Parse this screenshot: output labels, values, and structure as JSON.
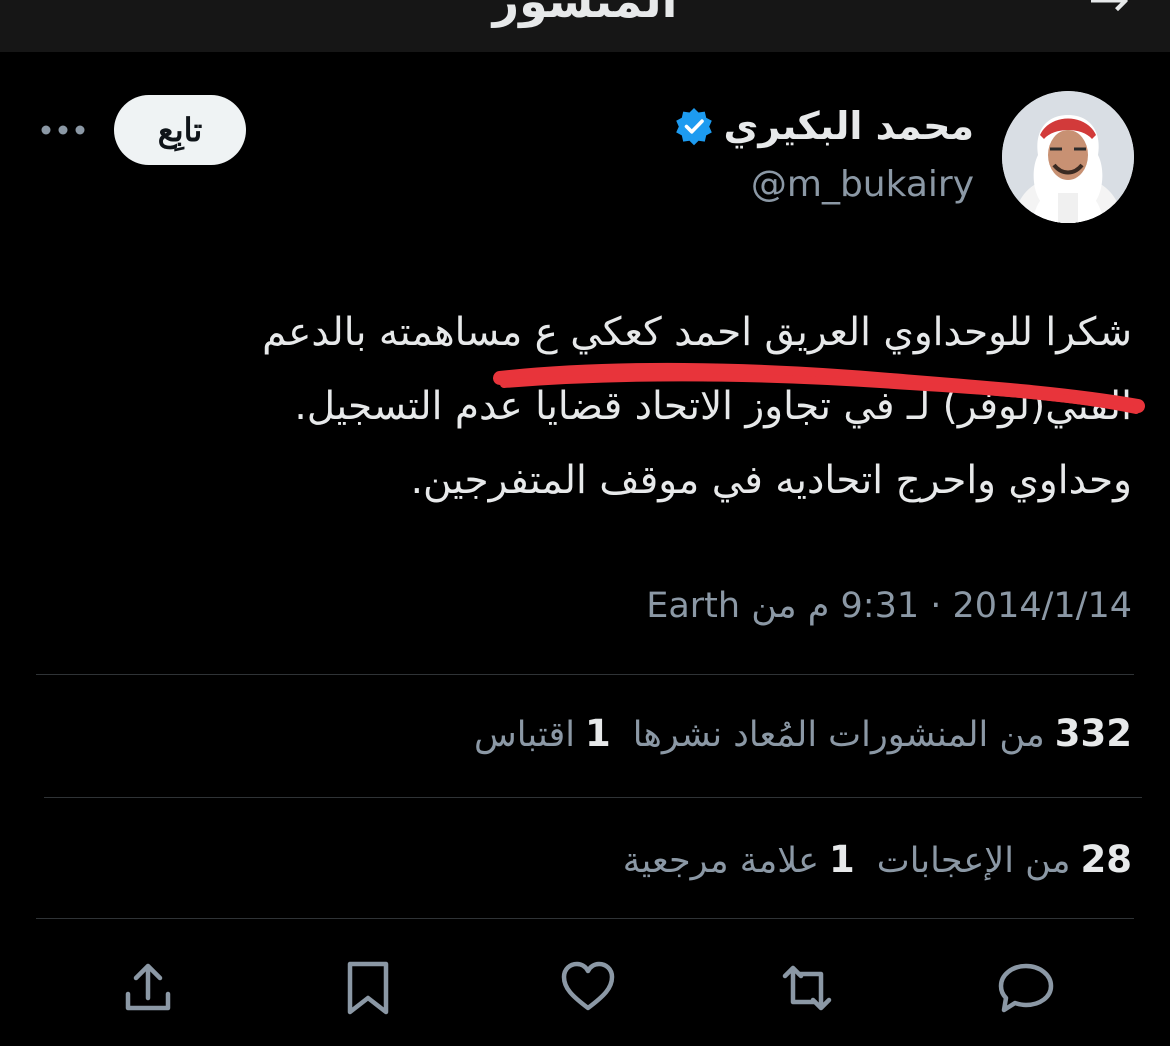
{
  "header": {
    "title": "المنشور"
  },
  "author": {
    "display_name": "محمد البكيري",
    "handle": "@m_bukairy",
    "verified": true
  },
  "follow_button": {
    "label": "تابِع"
  },
  "tweet": {
    "lines": [
      "شكرا للوحداوي العريق احمد كعكي ع مساهمته بالدعم",
      "الفني(لوفر) لـ في تجاوز الاتحاد قضايا عدم التسجيل.",
      "وحداوي واحرج اتحاديه في موقف المتفرجين."
    ],
    "timestamp": "2014/1/14 · 9:31 م من Earth"
  },
  "stats": {
    "reposts": {
      "count": "332",
      "label": "من المنشورات المُعاد نشرها"
    },
    "quotes": {
      "count": "1",
      "label": "اقتباس"
    },
    "likes": {
      "count": "28",
      "label": "من الإعجابات"
    },
    "bookmarks": {
      "count": "1",
      "label": "علامة مرجعية"
    }
  },
  "actions": [
    "reply-icon",
    "repost-icon",
    "like-icon",
    "bookmark-icon",
    "share-icon"
  ],
  "colors": {
    "background": "#000000",
    "text": "#e7e9ea",
    "secondary_text": "#8b98a5",
    "verified": "#1d9bf0",
    "strike_mark": "#e8343b",
    "divider": "#2f3336"
  }
}
